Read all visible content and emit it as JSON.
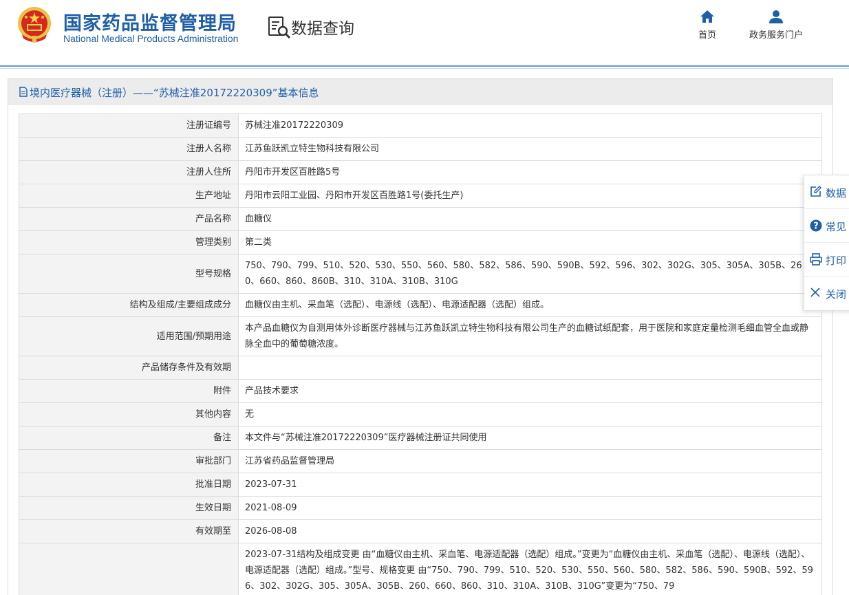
{
  "header": {
    "org_name_cn": "国家药品监督管理局",
    "org_name_en": "National Medical Products Administration",
    "query_title": "数据查询",
    "nav": {
      "home": "首页",
      "portal": "政务服务门户"
    }
  },
  "panel": {
    "title": "境内医疗器械（注册）——“苏械注准20172220309”基本信息"
  },
  "details": [
    {
      "label": "注册证编号",
      "value": "苏械注准20172220309"
    },
    {
      "label": "注册人名称",
      "value": "江苏鱼跃凯立特生物科技有限公司"
    },
    {
      "label": "注册人住所",
      "value": "丹阳市开发区百胜路5号"
    },
    {
      "label": "生产地址",
      "value": "丹阳市云阳工业园、丹阳市开发区百胜路1号(委托生产)"
    },
    {
      "label": "产品名称",
      "value": "血糖仪"
    },
    {
      "label": "管理类别",
      "value": "第二类"
    },
    {
      "label": "型号规格",
      "value": "750、790、799、510、520、530、550、560、580、582、586、590、590B、592、596、302、302G、305、305A、305B、260、660、860、860B、310、310A、310B、310G"
    },
    {
      "label": "结构及组成/主要组成成分",
      "value": "血糖仪由主机、采血笔（选配）、电源线（选配）、电源适配器（选配）组成。"
    },
    {
      "label": "适用范围/预期用途",
      "value": "本产品血糖仪为自测用体外诊断医疗器械与江苏鱼跃凯立特生物科技有限公司生产的血糖试纸配套，用于医院和家庭定量检测毛细血管全血或静脉全血中的葡萄糖浓度。"
    },
    {
      "label": "产品储存条件及有效期",
      "value": ""
    },
    {
      "label": "附件",
      "value": "产品技术要求"
    },
    {
      "label": "其他内容",
      "value": "无"
    },
    {
      "label": "备注",
      "value": "本文件与“苏械注准20172220309”医疗器械注册证共同使用"
    },
    {
      "label": "审批部门",
      "value": "江苏省药品监督管理局"
    },
    {
      "label": "批准日期",
      "value": "2023-07-31"
    },
    {
      "label": "生效日期",
      "value": "2021-08-09"
    },
    {
      "label": "有效期至",
      "value": "2026-08-08"
    },
    {
      "label": "",
      "value": "2023-07-31结构及组成变更 由“血糖仪由主机、采血笔、电源适配器（选配）组成。”变更为“血糖仪由主机、采血笔（选配）、电源线（选配）、电源适配器（选配）组成。”型号、规格变更 由“750、790、799、510、520、530、550、560、580、582、586、590、590B、592、596、302、302G、305、305A、305B、260、660、860、310、310A、310B、310G”变更为“750、79"
    }
  ],
  "side_toolbar": [
    {
      "label": "数据",
      "icon": "edit-icon"
    },
    {
      "label": "常见",
      "icon": "question-circle-icon"
    },
    {
      "label": "打印",
      "icon": "printer-icon"
    },
    {
      "label": "关闭",
      "icon": "close-icon"
    }
  ],
  "colors": {
    "brand_blue": "#1f5fa8",
    "header_rule": "#5a9fc9",
    "label_bg": "#f3f3f3",
    "panel_head_bg": "#ececec",
    "border": "#dcdcdc"
  }
}
